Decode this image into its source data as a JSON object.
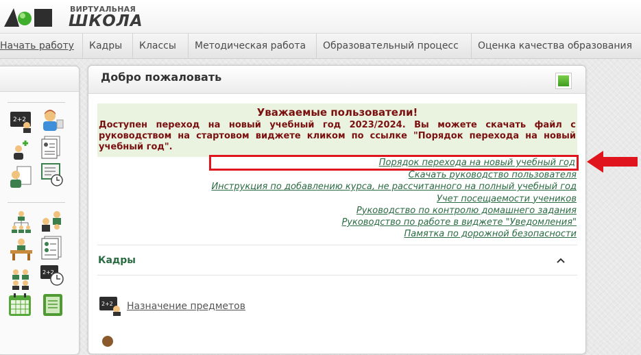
{
  "logo": {
    "top_text": "ВИРТУАЛЬНАЯ",
    "main_text": "ШКОЛА"
  },
  "nav": {
    "items": [
      "Начать работу",
      "Кадры",
      "Классы",
      "Методическая работа",
      "Образовательный процесс",
      "Оценка качества образования"
    ]
  },
  "sidebar": {
    "icons": [
      "blackboard-math-icon",
      "teacher-icon",
      "add-user-icon",
      "documents-icon",
      "user-doc-icon",
      "schedule-board-icon",
      "hierarchy-icon",
      "staff-transfer-icon",
      "desk-icon",
      "student-list-icon",
      "group-icon",
      "math-clock-icon",
      "calendar-icon",
      "green-notebook-icon"
    ]
  },
  "welcome": {
    "title": "Добро пожаловать",
    "notice_title": "Уважаемые пользователи!",
    "notice_body": "Доступен переход на новый учебный год 2023/2024. Вы можете скачать файл с руководством на стартовом виджете кликом по ссылке \"Порядок перехода на новый учебный год\".",
    "links": [
      "Порядок перехода на новый учебный год",
      "Скачать руководство пользователя",
      "Инструкция по добавлению курса, не рассчитанного на полный учебный год",
      "Учет посещаемости учеников",
      "Руководство по контролю домашнего задания",
      "Руководство по работе в виджете \"Уведомления\"",
      "Памятка по дорожной безопасности"
    ]
  },
  "kadry": {
    "title": "Кадры",
    "item": "Назначение предметов"
  },
  "colors": {
    "accent_green": "#2a6b42",
    "notice_text": "#7a1010",
    "notice_bg": "#eaf3df",
    "highlight_red": "#e0141c"
  }
}
